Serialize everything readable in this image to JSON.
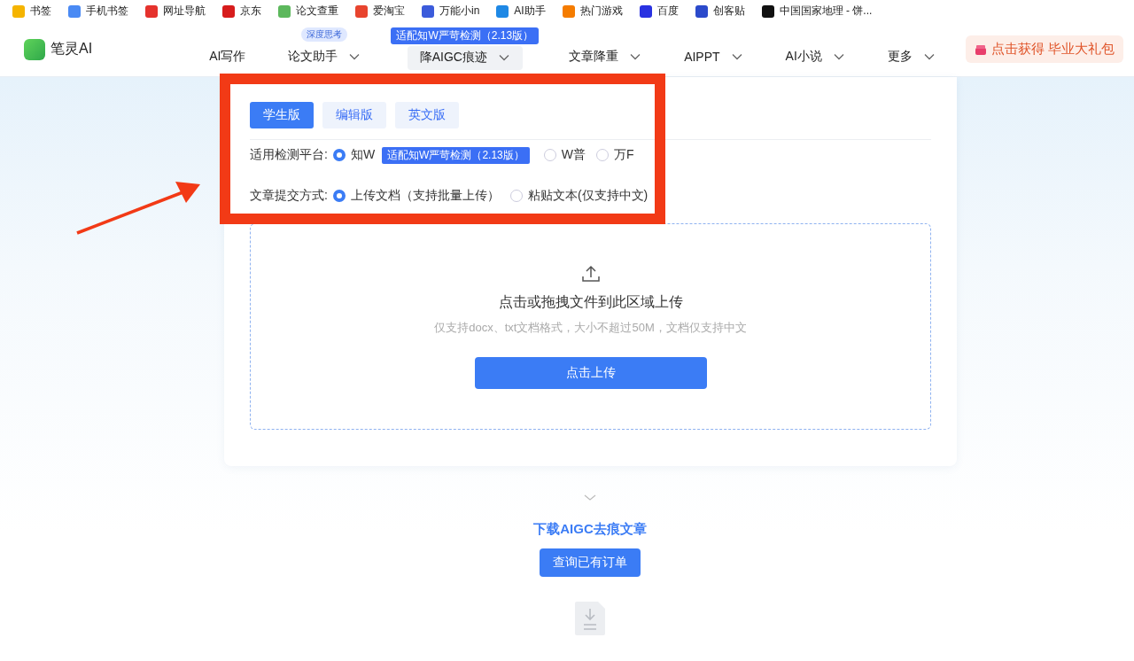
{
  "bookmarks": [
    {
      "label": "书签",
      "color": "#f5b400"
    },
    {
      "label": "手机书签",
      "color": "#4a8af4"
    },
    {
      "label": "网址导航",
      "color": "#e5322d"
    },
    {
      "label": "京东",
      "color": "#d71c1c"
    },
    {
      "label": "论文查重",
      "color": "#5cb85c"
    },
    {
      "label": "爱淘宝",
      "color": "#e8442e"
    },
    {
      "label": "万能小in",
      "color": "#3b5bdb"
    },
    {
      "label": "AI助手",
      "color": "#1e88e5"
    },
    {
      "label": "热门游戏",
      "color": "#f57c00"
    },
    {
      "label": "百度",
      "color": "#2932e1"
    },
    {
      "label": "创客贴",
      "color": "#2b4acb"
    },
    {
      "label": "中国国家地理 - 饼...",
      "color": "#111111"
    }
  ],
  "brand": {
    "name": "笔灵AI"
  },
  "nav": {
    "items": [
      {
        "label": "AI写作",
        "has_menu": false,
        "selected": false
      },
      {
        "label": "论文助手",
        "has_menu": true,
        "selected": false,
        "badge": "深度思考"
      },
      {
        "label": "降AIGC痕迹",
        "has_menu": true,
        "selected": true,
        "badge": "适配知W严苛检测（2.13版）"
      },
      {
        "label": "文章降重",
        "has_menu": true,
        "selected": false
      },
      {
        "label": "AIPPT",
        "has_menu": true,
        "selected": false
      },
      {
        "label": "AI小说",
        "has_menu": true,
        "selected": false
      },
      {
        "label": "更多",
        "has_menu": true,
        "selected": false
      }
    ],
    "promo": "点击获得 毕业大礼包"
  },
  "card": {
    "tabs": [
      {
        "label": "学生版",
        "selected": true
      },
      {
        "label": "编辑版",
        "selected": false
      },
      {
        "label": "英文版",
        "selected": false
      }
    ],
    "settings": [
      {
        "label": "适用检测平台:",
        "options": [
          {
            "label": "知W",
            "selected": true,
            "tag": "适配知W严苛检测（2.13版）"
          },
          {
            "label": "W普",
            "selected": false
          },
          {
            "label": "万F",
            "selected": false
          }
        ]
      },
      {
        "label": "文章提交方式:",
        "options": [
          {
            "label": "上传文档（支持批量上传）",
            "selected": true
          },
          {
            "label": "粘贴文本(仅支持中文)",
            "selected": false
          }
        ]
      }
    ],
    "upload": {
      "title": "点击或拖拽文件到此区域上传",
      "hint": "仅支持docx、txt文档格式，大小不超过50M，文档仅支持中文",
      "button": "点击上传"
    }
  },
  "download": {
    "title": "下载AIGC去痕文章",
    "button": "查询已有订单"
  }
}
